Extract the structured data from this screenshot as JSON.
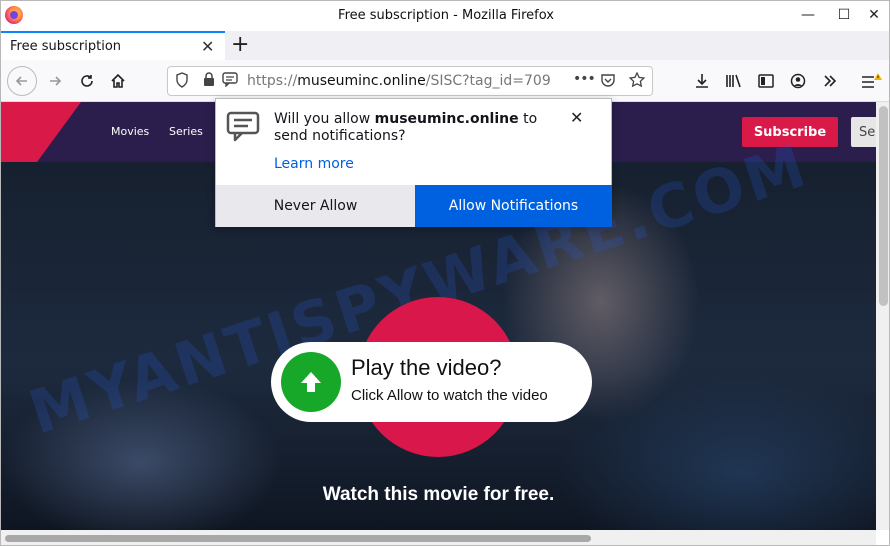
{
  "window": {
    "title": "Free subscription - Mozilla Firefox",
    "controls": {
      "minimize": "—",
      "maximize": "☐",
      "close": "✕"
    }
  },
  "tab": {
    "title": "Free subscription",
    "close": "✕",
    "new_tab": "+"
  },
  "urlbar": {
    "prefix": "https://",
    "domain": "museuminc.online",
    "path": "/SISC?tag_id=709",
    "more": "•••"
  },
  "site": {
    "nav": [
      "Movies",
      "Series"
    ],
    "subscribe_label": "Subscribe",
    "signin_label": "Se",
    "play_title": "Play the video?",
    "play_sub": "Click Allow to watch the video",
    "watch_text": "Watch this movie for free.",
    "watermark": "MYANTISPYWARE.COM",
    "accent_color": "#d91a49",
    "play_icon_color": "#17a82a"
  },
  "notification": {
    "prefix": "Will you allow ",
    "domain": "museuminc.online",
    "suffix": " to send notifications?",
    "learn_more": "Learn more",
    "close": "✕",
    "never_allow": "Never Allow",
    "allow": "Allow Notifications",
    "allow_color": "#0061e0"
  }
}
